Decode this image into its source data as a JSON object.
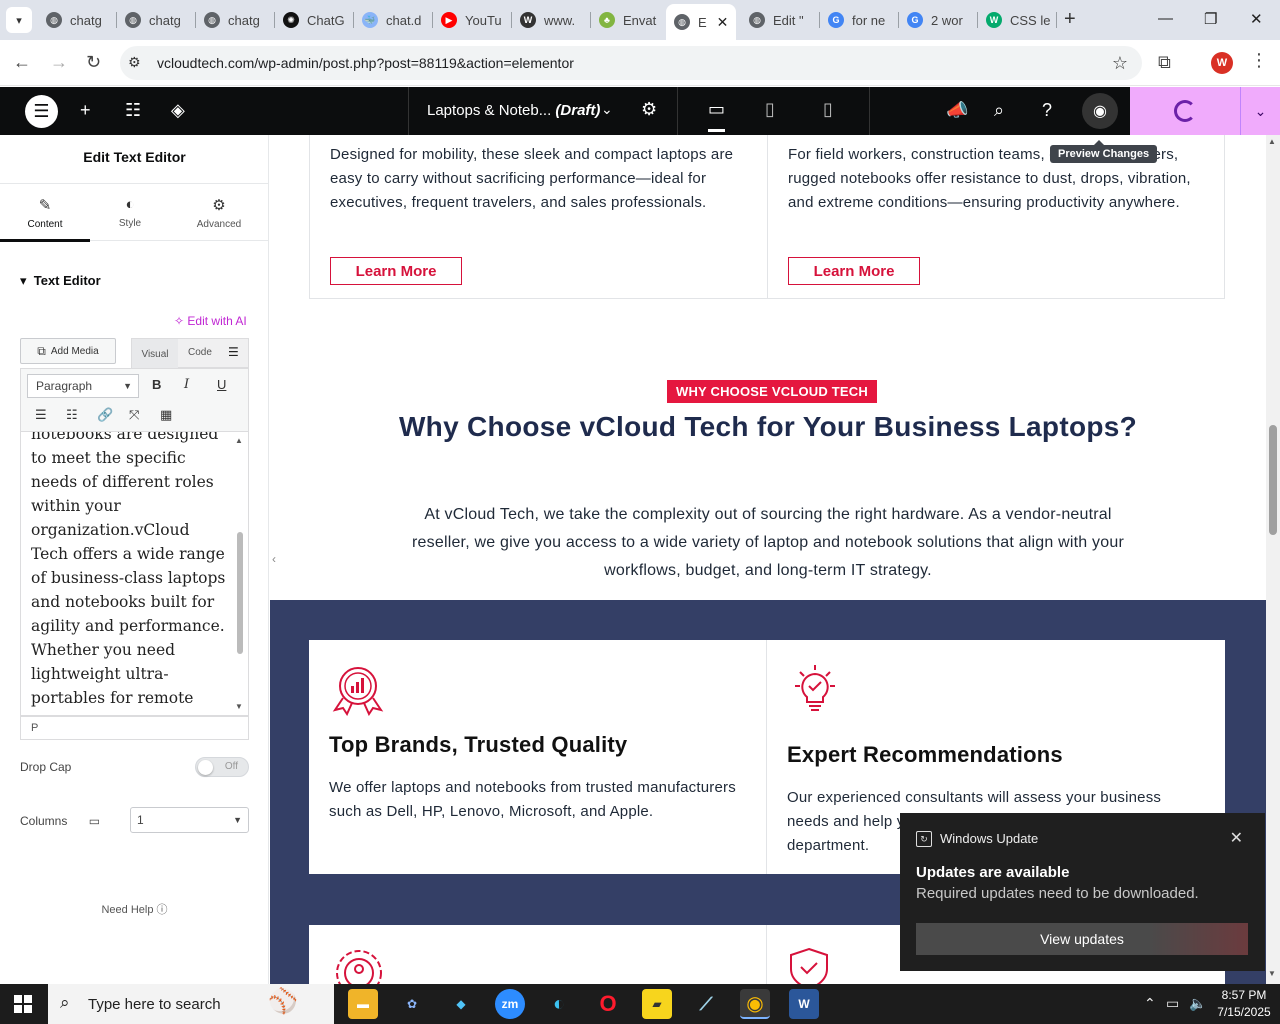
{
  "browser": {
    "tabs": [
      {
        "label": "chatg",
        "icon": "link-icon",
        "color": "#5f6368"
      },
      {
        "label": "chatg",
        "icon": "link-icon",
        "color": "#5f6368"
      },
      {
        "label": "chatg",
        "icon": "link-icon",
        "color": "#5f6368"
      },
      {
        "label": "ChatG",
        "icon": "openai-icon",
        "color": "#111111"
      },
      {
        "label": "chat.d",
        "icon": "deepseek-icon",
        "color": "#8ab4f8"
      },
      {
        "label": "YouTu",
        "icon": "youtube-icon",
        "color": "#ff0000"
      },
      {
        "label": "www.",
        "icon": "wordpress-w-icon",
        "color": "#333333"
      },
      {
        "label": "Envat",
        "icon": "envato-icon",
        "color": "#82b541"
      },
      {
        "label": "E",
        "icon": "link-icon",
        "color": "#5f6368",
        "active": true
      },
      {
        "label": "Edit \"",
        "icon": "link-icon",
        "color": "#5f6368"
      },
      {
        "label": "for ne",
        "icon": "google-icon",
        "color": "#4285f4"
      },
      {
        "label": "2 wor",
        "icon": "google-icon",
        "color": "#4285f4"
      },
      {
        "label": "CSS le",
        "icon": "w3schools-icon",
        "color": "#04aa6d"
      }
    ],
    "url": "vcloudtech.com/wp-admin/post.php?post=88119&action=elementor",
    "profile_initial": "W"
  },
  "elementor": {
    "doc_title": "Laptops & Noteb...",
    "doc_status": "(Draft)",
    "tooltip": "Preview Changes"
  },
  "panel": {
    "title": "Edit Text Editor",
    "tabs": [
      {
        "label": "Content",
        "icon": "pencil-icon"
      },
      {
        "label": "Style",
        "icon": "half-circle-icon"
      },
      {
        "label": "Advanced",
        "icon": "gear-icon"
      }
    ],
    "section": "Text Editor",
    "edit_ai": "Edit with AI",
    "add_media": "Add Media",
    "visual": "Visual",
    "code": "Code",
    "paragraph": "Paragraph",
    "editor_text": "notebooks are designed to meet the specific needs of different roles within your organization.vCloud Tech offers a wide range of business-class laptops and notebooks built for agility and performance. Whether you need lightweight ultra-portables for remote teams, rugged laptops for field operations, or high-performance mobile",
    "path": "P",
    "drop_cap_label": "Drop Cap",
    "drop_cap_value": "Off",
    "columns_label": "Columns",
    "columns_value": "1",
    "need_help": "Need Help"
  },
  "canvas": {
    "card_left_text": "Designed for mobility, these sleek and compact laptops are easy to carry without sacrificing performance—ideal for executives, frequent travelers, and sales professionals.",
    "card_right_text": "For field workers, construction teams, or first responders, rugged notebooks offer resistance to dust, drops, vibration, and extreme conditions—ensuring productivity anywhere.",
    "learn_more": "Learn More",
    "why_badge": "WHY CHOOSE VCLOUD TECH",
    "why_title": "Why Choose vCloud Tech for Your Business Laptops?",
    "why_body": "At vCloud Tech, we take the complexity out of sourcing the right hardware. As a vendor-neutral reseller, we give you access to a wide variety of laptop and notebook solutions that align with your workflows, budget, and long-term IT strategy.",
    "feature1_title": "Top Brands, Trusted Quality",
    "feature1_text": "We offer laptops and notebooks from trusted manufacturers such as Dell, HP, Lenovo, Microsoft, and Apple.",
    "feature2_title": "Expert Recommendations",
    "feature2_text": "Our experienced consultants will assess your business needs and help you select the right devices for every team or department.",
    "accent": "#e5173f",
    "navy": "#343f66"
  },
  "toast": {
    "app": "Windows Update",
    "heading": "Updates are available",
    "body": "Required updates need to be downloaded.",
    "button": "View updates"
  },
  "taskbar": {
    "search_placeholder": "Type here to search",
    "time": "8:57 PM",
    "date": "7/15/2025"
  }
}
